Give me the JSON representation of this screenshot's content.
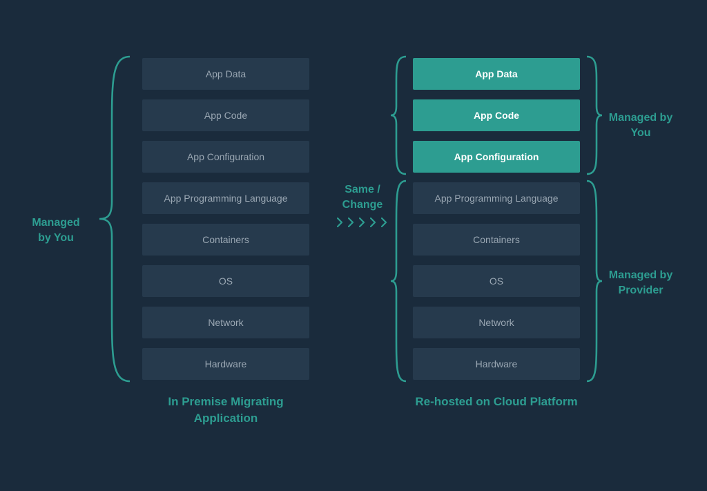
{
  "layers": [
    "App Data",
    "App Code",
    "App Configuration",
    "App Programming Language",
    "Containers",
    "OS",
    "Network",
    "Hardware"
  ],
  "right_highlight_count": 3,
  "left_caption": "In Premise Migrating Application",
  "right_caption": "Re-hosted on Cloud Platform",
  "labels": {
    "left": "Managed by You",
    "center_line1": "Same /",
    "center_line2": "Change",
    "right_top": "Managed by You",
    "right_bot": "Managed by Provider"
  },
  "colors": {
    "background": "#1a2b3c",
    "layer_bg": "#263a4d",
    "layer_text": "#9aa7b3",
    "accent": "#2d9d91",
    "highlight_text": "#ffffff"
  }
}
